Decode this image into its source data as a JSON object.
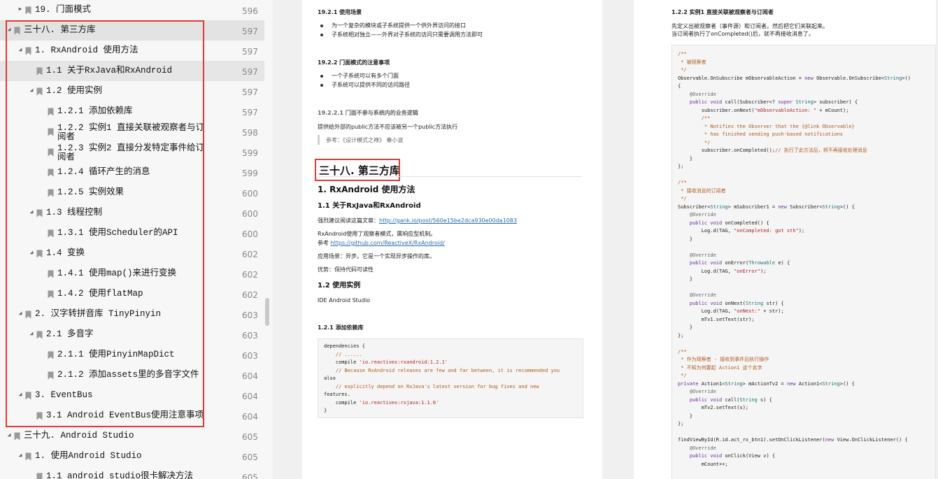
{
  "toc": {
    "items": [
      {
        "label": "19. 门面模式",
        "page": "596",
        "indent": 0,
        "arrow": "right",
        "state": ""
      },
      {
        "label": "三十八. 第三方库",
        "page": "597",
        "indent": -1,
        "arrow": "down",
        "state": "selected"
      },
      {
        "label": "1. RxAndroid 使用方法",
        "page": "597",
        "indent": 1,
        "arrow": "down",
        "state": ""
      },
      {
        "label": "1.1 关于RxJava和RxAndroid",
        "page": "597",
        "indent": 2,
        "arrow": "",
        "state": "current"
      },
      {
        "label": "1.2 使用实例",
        "page": "597",
        "indent": 2,
        "arrow": "down",
        "state": ""
      },
      {
        "label": "1.2.1 添加依赖库",
        "page": "597",
        "indent": 3,
        "arrow": "",
        "state": ""
      },
      {
        "label": "1.2.2 实例1 直接关联被观察者与订阅者",
        "page": "598",
        "indent": 3,
        "arrow": "",
        "state": "",
        "wrap": true
      },
      {
        "label": "1.2.3 实例2 直接分发特定事件给订阅者",
        "page": "599",
        "indent": 3,
        "arrow": "",
        "state": "",
        "wrap": true
      },
      {
        "label": "1.2.4 循环产生的消息",
        "page": "599",
        "indent": 3,
        "arrow": "",
        "state": ""
      },
      {
        "label": "1.2.5 实例效果",
        "page": "600",
        "indent": 3,
        "arrow": "",
        "state": ""
      },
      {
        "label": "1.3 线程控制",
        "page": "600",
        "indent": 2,
        "arrow": "down",
        "state": ""
      },
      {
        "label": "1.3.1 使用Scheduler的API",
        "page": "600",
        "indent": 3,
        "arrow": "",
        "state": ""
      },
      {
        "label": "1.4 变换",
        "page": "602",
        "indent": 2,
        "arrow": "down",
        "state": ""
      },
      {
        "label": "1.4.1 使用map()来进行变换",
        "page": "602",
        "indent": 3,
        "arrow": "",
        "state": ""
      },
      {
        "label": "1.4.2 使用flatMap",
        "page": "602",
        "indent": 3,
        "arrow": "",
        "state": ""
      },
      {
        "label": "2. 汉字转拼音库 TinyPinyin",
        "page": "603",
        "indent": 1,
        "arrow": "down",
        "state": ""
      },
      {
        "label": "2.1 多音字",
        "page": "603",
        "indent": 2,
        "arrow": "down",
        "state": ""
      },
      {
        "label": "2.1.1 使用PinyinMapDict",
        "page": "603",
        "indent": 3,
        "arrow": "",
        "state": ""
      },
      {
        "label": "2.1.2 添加assets里的多音字文件",
        "page": "604",
        "indent": 3,
        "arrow": "",
        "state": ""
      },
      {
        "label": "3. EventBus",
        "page": "604",
        "indent": 1,
        "arrow": "down",
        "state": ""
      },
      {
        "label": "3.1 Android EventBus使用注意事项",
        "page": "604",
        "indent": 2,
        "arrow": "",
        "state": ""
      },
      {
        "label": "三十九. Android Studio",
        "page": "605",
        "indent": -1,
        "arrow": "down",
        "state": ""
      },
      {
        "label": "1. 使用Android Studio",
        "page": "605",
        "indent": 1,
        "arrow": "down",
        "state": ""
      },
      {
        "label": "1.1 android studio很卡解决方法",
        "page": "605",
        "indent": 2,
        "arrow": "",
        "state": ""
      }
    ]
  },
  "left_page": {
    "h_1921": "19.2.1 使用场景",
    "b1": "为一个复杂的模块或子系统提供一个供外界访问的接口",
    "b2": "子系统相对独立——外界对子系统的访问只需要调用方法即可",
    "h_1922": "19.2.2 门面模式的注意事项",
    "b3": "一个子系统可以有多个门面",
    "b4": "子系统可以提供不同的访问路径",
    "h_19221": "19.2.2.1 门面不参与系统内的业务逻辑",
    "p1": "提供给外部的public方法不应该被另一个public方法执行",
    "quote": "参考：《设计模式之禅》 秦小波",
    "h1": "三十八. 第三方库",
    "h2": "1. RxAndroid 使用方法",
    "h3_11": "1.1 关于RxJava和RxAndroid",
    "p2_prefix": "强烈建议阅读这篇文章：",
    "p2_link": "http://gank.io/post/560e15be2dca930e00da1083",
    "p3": "RxAndroid使用了观察者模式，属响应型机制。",
    "p4_prefix": "参考 ",
    "p4_link": "https://github.com/ReactiveX/RxAndroid/",
    "p5": "应用场景：异步。它是一个实现异步操作的库。",
    "p6": "优势：保持代码可读性",
    "h3_12": "1.2 使用实例",
    "p7": "IDE Android Studio",
    "h4_121": "1.2.1 添加依赖库",
    "code": [
      "dependencies {",
      "    // ......",
      "    compile 'io.reactivex:rxandroid:1.2.1'",
      "    // Because RxAndroid releases are few and far between, it is recommended you",
      "also",
      "    // explicitly depend on RxJava's latest version for bug fixes and new",
      "features.",
      "    compile 'io.reactivex:rxjava:1.1.6'",
      "}"
    ]
  },
  "right_page": {
    "h4": "1.2.2 实例1 直接关联被观察者与订阅者",
    "p1": "先定义出被观察者（事件源）和订阅者。然后把它们关联起来。",
    "p2": "当订阅者执行了onCompleted()后，就不再接收消息了。",
    "code": [
      "/**",
      " * 被观察者",
      " */",
      "Observable.OnSubscribe mObservableAction = new Observable.OnSubscribe<String>()",
      "{",
      "    @Override",
      "    public void call(Subscriber<? super String> subscriber) {",
      "        subscriber.onNext(\"mObservableAction: \" + mCount);",
      "        /**",
      "         * Notifies the Observer that the {@link Observable}",
      "         * has finished sending push-based notifications",
      "         */",
      "        subscriber.onCompleted();// 执行了此方法后，将不再接收处理消息",
      "    }",
      "};",
      "",
      "/**",
      " * 接收消息的订阅者",
      " */",
      "Subscriber<String> mSubscriber1 = new Subscriber<String>() {",
      "    @Override",
      "    public void onCompleted() {",
      "        Log.d(TAG, \"onCompleted: got sth\");",
      "    }",
      "",
      "    @Override",
      "    public void onError(Throwable e) {",
      "        Log.d(TAG, \"onError\");",
      "    }",
      "",
      "    @Override",
      "    public void onNext(String str) {",
      "        Log.d(TAG, \"onNext:\" + str);",
      "        mTv1.setText(str);",
      "    }",
      "};",
      "",
      "/**",
      " * 作为观察者 - 接收到事件后执行操作",
      " * 不知为何要起 Action1 这个名字",
      " */",
      "private Action1<String> mActionTv2 = new Action1<String>() {",
      "    @Override",
      "    public void call(String s) {",
      "        mTv2.setText(s);",
      "    }",
      "};",
      "",
      "findViewById(R.id.act_rx_btn1).setOnClickListener(new View.OnClickListener() {",
      "    @Override",
      "    public void onClick(View v) {",
      "        mCount++;"
    ]
  },
  "colors": {
    "highlight": "#e53935",
    "link": "#2b6cb0",
    "selected": "#e3e3e3"
  }
}
